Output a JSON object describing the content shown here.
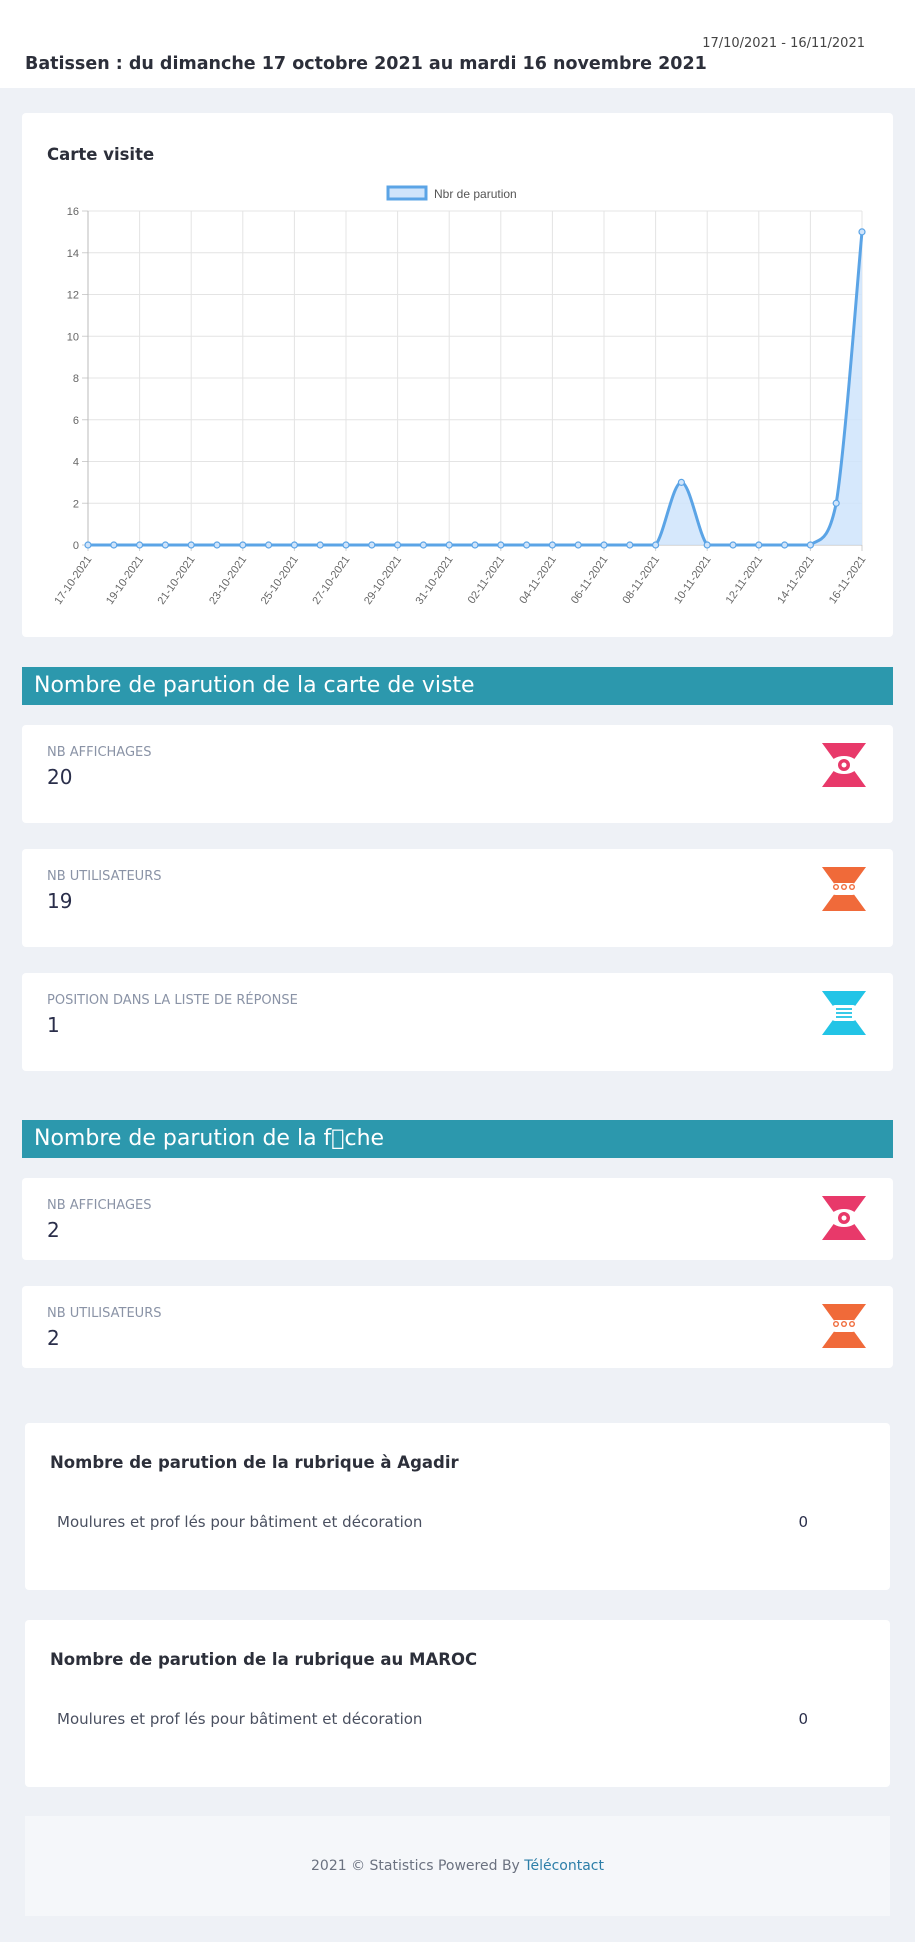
{
  "header": {
    "date_range": "17/10/2021 - 16/11/2021",
    "title": "Batissen : du dimanche 17 octobre 2021 au mardi 16 novembre 2021"
  },
  "chart_card": {
    "title": "Carte visite"
  },
  "chart_data": {
    "type": "area",
    "legend": "Nbr de parution",
    "legend_position": "top-center",
    "grid": true,
    "ylim": [
      0,
      16
    ],
    "y_ticks": [
      0,
      2,
      4,
      6,
      8,
      10,
      12,
      14,
      16
    ],
    "x": [
      "17-10-2021",
      "18-10-2021",
      "19-10-2021",
      "20-10-2021",
      "21-10-2021",
      "22-10-2021",
      "23-10-2021",
      "24-10-2021",
      "25-10-2021",
      "26-10-2021",
      "27-10-2021",
      "28-10-2021",
      "29-10-2021",
      "30-10-2021",
      "31-10-2021",
      "01-11-2021",
      "02-11-2021",
      "03-11-2021",
      "04-11-2021",
      "05-11-2021",
      "06-11-2021",
      "07-11-2021",
      "08-11-2021",
      "09-11-2021",
      "10-11-2021",
      "11-11-2021",
      "12-11-2021",
      "13-11-2021",
      "14-11-2021",
      "15-11-2021",
      "16-11-2021"
    ],
    "x_tick_labels": [
      "17-10-2021",
      "19-10-2021",
      "21-10-2021",
      "23-10-2021",
      "25-10-2021",
      "27-10-2021",
      "29-10-2021",
      "31-10-2021",
      "02-11-2021",
      "04-11-2021",
      "06-11-2021",
      "08-11-2021",
      "10-11-2021",
      "12-11-2021",
      "14-11-2021",
      "16-11-2021"
    ],
    "series": [
      {
        "name": "Nbr de parution",
        "values": [
          0,
          0,
          0,
          0,
          0,
          0,
          0,
          0,
          0,
          0,
          0,
          0,
          0,
          0,
          0,
          0,
          0,
          0,
          0,
          0,
          0,
          0,
          0,
          3,
          0,
          0,
          0,
          0,
          0,
          2,
          15
        ]
      }
    ],
    "colors": {
      "line": "#5ba4e6",
      "fill": "#cfe4fb"
    }
  },
  "section_carte": {
    "banner": "Nombre de parution de la carte de viste",
    "stats": [
      {
        "label": "NB AFFICHAGES",
        "value": "20",
        "icon": "eye-icon",
        "color": "#e8396a"
      },
      {
        "label": "NB UTILISATEURS",
        "value": "19",
        "icon": "users-icon",
        "color": "#f06a3a"
      },
      {
        "label": "POSITION DANS LA LISTE DE RÉPONSE",
        "value": "1",
        "icon": "list-icon",
        "color": "#22c4e6"
      }
    ]
  },
  "section_fiche": {
    "banner": "Nombre de parution de la f\u0000che",
    "stats": [
      {
        "label": "NB AFFICHAGES",
        "value": "2",
        "icon": "eye-icon",
        "color": "#e8396a"
      },
      {
        "label": "NB UTILISATEURS",
        "value": "2",
        "icon": "users-icon",
        "color": "#f06a3a"
      }
    ]
  },
  "rubrique_agadir": {
    "title": "Nombre de parution de la rubrique à Agadir",
    "item": "Moulures et prof lés pour bâtiment et décoration",
    "count": "0"
  },
  "rubrique_maroc": {
    "title": "Nombre de parution de la rubrique au MAROC",
    "item": "Moulures et prof lés pour bâtiment et décoration",
    "count": "0"
  },
  "footer": {
    "text": "2021 © Statistics Powered By",
    "link": "Télécontact"
  }
}
